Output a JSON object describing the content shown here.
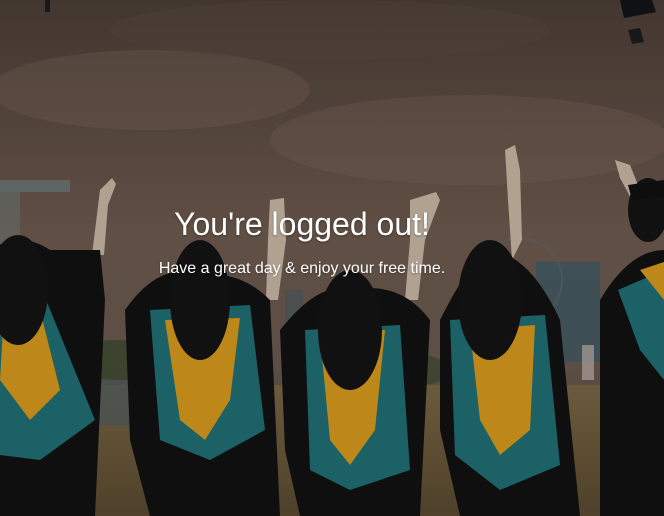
{
  "logout": {
    "title": "You're logged out!",
    "subtitle": "Have a great day & enjoy your free time."
  },
  "background": {
    "description_icon": "graduation-photo",
    "tint": "#3a322d",
    "gown_color": "#121212",
    "hood_teal": "#1f6f73",
    "hood_gold": "#d99a1e",
    "sky": "#6e5a4e",
    "ground": "#6b5838"
  }
}
